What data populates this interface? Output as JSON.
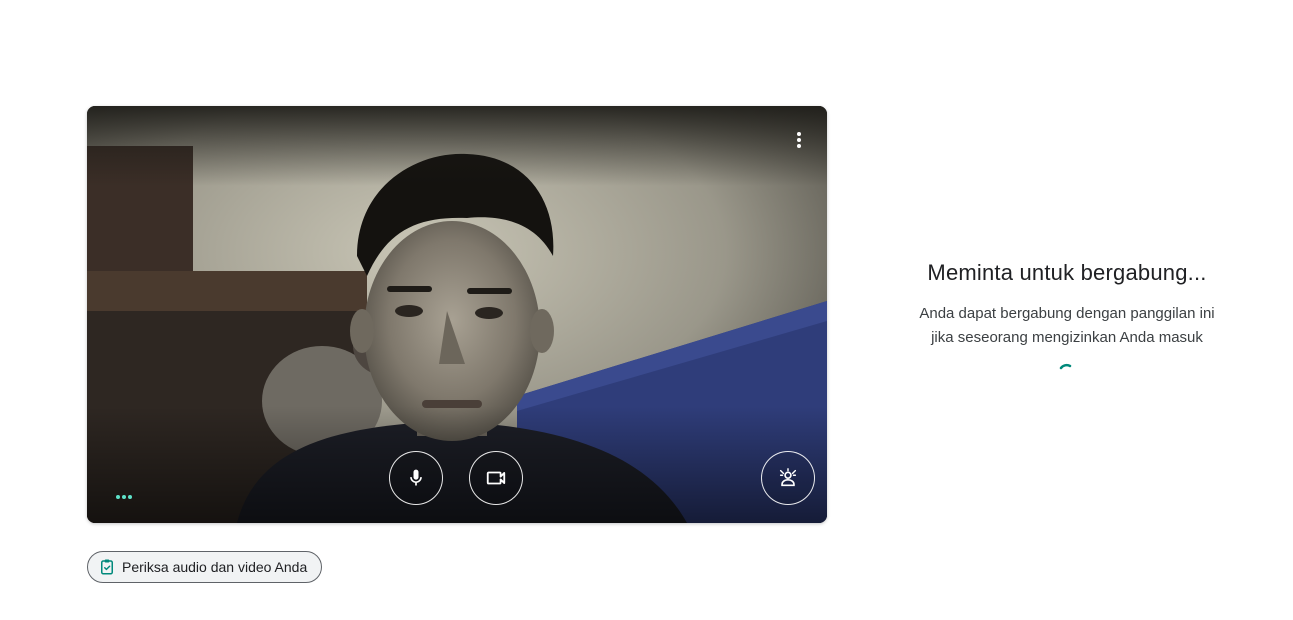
{
  "preview": {
    "more_options_icon": "more-vert-icon",
    "mic_icon": "microphone-icon",
    "camera_icon": "videocam-icon",
    "effects_icon": "visual-effects-icon",
    "audio_level_icon": "audio-level-dots-icon"
  },
  "check_button": {
    "label": "Periksa audio dan video Anda",
    "icon": "clipboard-check-icon"
  },
  "join_status": {
    "title": "Meminta untuk bergabung...",
    "description": "Anda dapat bergabung dengan panggilan ini jika seseorang mengizinkan Anda masuk",
    "spinner_icon": "loading-spinner-icon"
  },
  "colors": {
    "accent": "#00897b",
    "level_dots": "#5ee2c9",
    "text_primary": "#202124",
    "text_secondary": "#3c4043"
  }
}
